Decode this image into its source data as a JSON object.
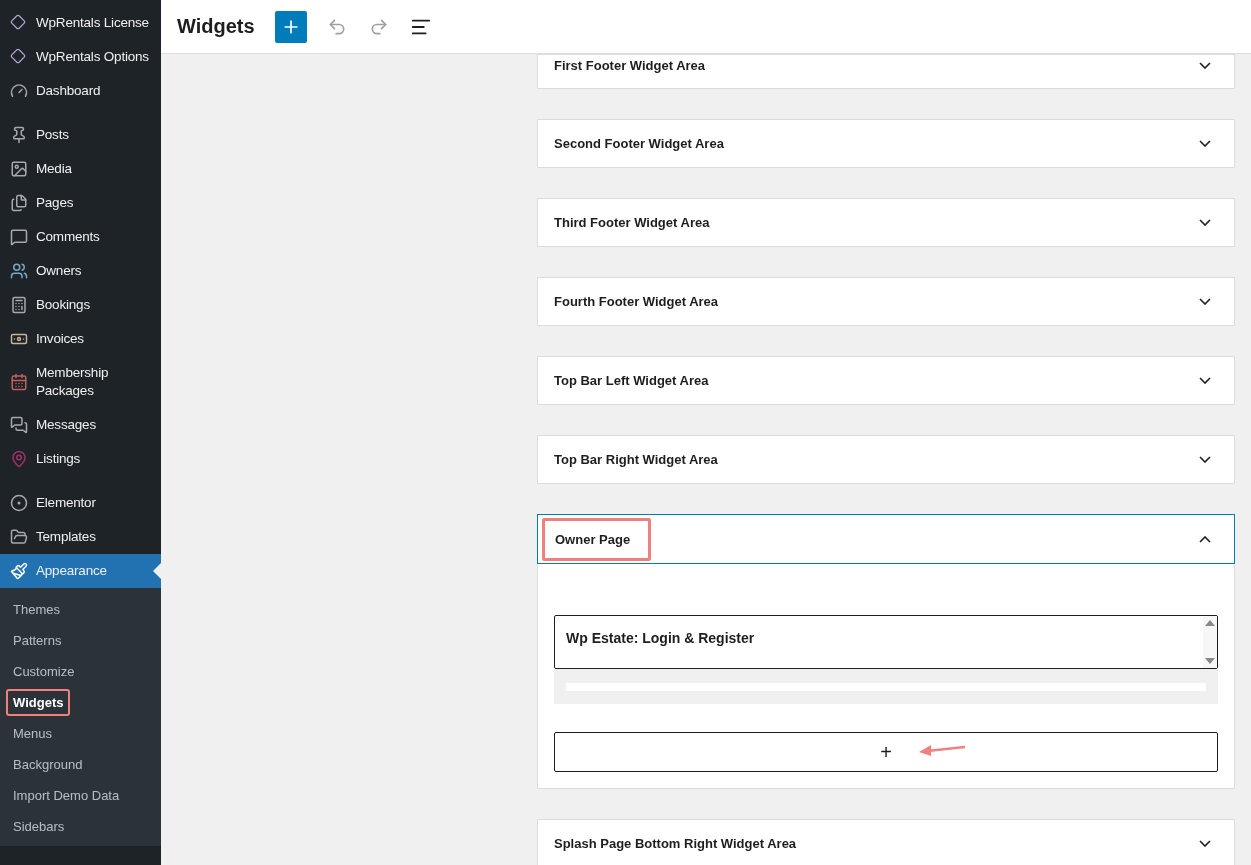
{
  "sidebar": {
    "groups": [
      {
        "items": [
          {
            "label": "WpRentals License",
            "selected": false
          },
          {
            "label": "WpRentals Options",
            "selected": false
          },
          {
            "label": "Dashboard",
            "selected": false
          }
        ]
      },
      {
        "items": [
          {
            "label": "Posts",
            "selected": false
          },
          {
            "label": "Media",
            "selected": false
          },
          {
            "label": "Pages",
            "selected": false
          },
          {
            "label": "Comments",
            "selected": false
          },
          {
            "label": "Owners",
            "selected": false
          },
          {
            "label": "Bookings",
            "selected": false
          },
          {
            "label": "Invoices",
            "selected": false
          },
          {
            "label": "Membership Packages",
            "selected": false
          },
          {
            "label": "Messages",
            "selected": false
          },
          {
            "label": "Listings",
            "selected": false
          }
        ]
      },
      {
        "items": [
          {
            "label": "Elementor",
            "selected": false
          },
          {
            "label": "Templates",
            "selected": false
          },
          {
            "label": "Appearance",
            "selected": true,
            "children": [
              {
                "label": "Themes",
                "selected": false,
                "highlighted": false
              },
              {
                "label": "Patterns",
                "selected": false,
                "highlighted": false
              },
              {
                "label": "Customize",
                "selected": false,
                "highlighted": false
              },
              {
                "label": "Widgets",
                "selected": true,
                "highlighted": true
              },
              {
                "label": "Menus",
                "selected": false,
                "highlighted": false
              },
              {
                "label": "Background",
                "selected": false,
                "highlighted": false
              },
              {
                "label": "Import Demo Data",
                "selected": false,
                "highlighted": false
              },
              {
                "label": "Sidebars",
                "selected": false,
                "highlighted": false
              }
            ]
          }
        ]
      }
    ]
  },
  "header": {
    "title": "Widgets",
    "tools": [
      {
        "kind": "add"
      },
      {
        "kind": "undo",
        "disabled": true
      },
      {
        "kind": "redo",
        "disabled": true
      },
      {
        "kind": "list",
        "disabled": false
      }
    ]
  },
  "areas": [
    {
      "title": "First Footer Widget Area",
      "expanded": false,
      "highlighted": false
    },
    {
      "title": "Second Footer Widget Area",
      "expanded": false,
      "highlighted": false
    },
    {
      "title": "Third Footer Widget Area",
      "expanded": false,
      "highlighted": false
    },
    {
      "title": "Fourth Footer Widget Area",
      "expanded": false,
      "highlighted": false
    },
    {
      "title": "Top Bar Left Widget Area",
      "expanded": false,
      "highlighted": false
    },
    {
      "title": "Top Bar Right Widget Area",
      "expanded": false,
      "highlighted": false
    },
    {
      "title": "Owner Page",
      "expanded": true,
      "highlighted": true,
      "widgets": [
        {
          "title": "Wp Estate: Login & Register"
        }
      ],
      "add_button": {
        "label": "+",
        "annotated": true
      }
    },
    {
      "title": "Splash Page Bottom Right Widget Area",
      "expanded": false,
      "highlighted": false
    }
  ]
}
